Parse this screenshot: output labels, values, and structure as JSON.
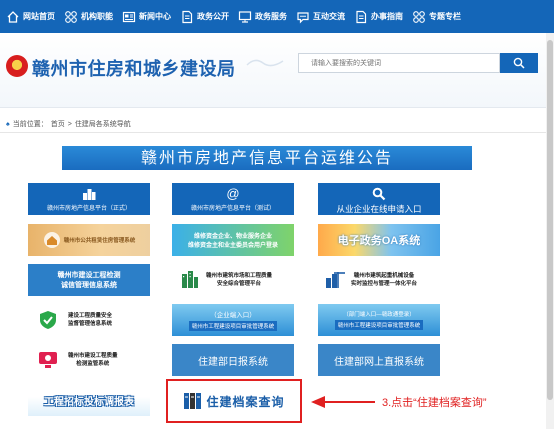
{
  "nav": {
    "items": [
      {
        "label": "网站首页",
        "icon": "home-icon"
      },
      {
        "label": "机构职能",
        "icon": "grid-icon"
      },
      {
        "label": "新闻中心",
        "icon": "news-icon"
      },
      {
        "label": "政务公开",
        "icon": "document-icon"
      },
      {
        "label": "政务服务",
        "icon": "monitor-icon"
      },
      {
        "label": "互动交流",
        "icon": "chat-icon"
      },
      {
        "label": "办事指南",
        "icon": "document-icon"
      },
      {
        "label": "专题专栏",
        "icon": "grid-icon"
      }
    ]
  },
  "header": {
    "site_title": "赣州市住房和城乡建设局",
    "search_placeholder": "请输入要搜索的关键词"
  },
  "breadcrumb": {
    "prefix": "当前位置：",
    "home": "首页",
    "separator": ">",
    "current": "住建局各系统导航"
  },
  "banner": {
    "title": "赣州市房地产信息平台运维公告"
  },
  "tiles": {
    "r1c1": "赣州市房地产信息平台（正式）",
    "r1c2": "赣州市房地产信息平台（测试）",
    "r1c3": "从业企业在线申请入口",
    "r2c1": "赣州市公共租赁住房管理系统",
    "r2c2_line1": "维修资金企业、物业服务企业",
    "r2c2_line2": "维修资金主和业主委员会用户登录",
    "r2c3": "电子政务OA系统",
    "r3c1_line1": "赣州市建设工程检测",
    "r3c1_line2": "诚信管理信息系统",
    "r3c2_line1": "赣州市建筑市场和工程质量",
    "r3c2_line2": "安全综合管理平台",
    "r3c3_line1": "赣州市建筑起重机械设备",
    "r3c3_line2": "实时监控与管理一体化平台",
    "r4c1_line1": "建设工程质量安全",
    "r4c1_line2": "监督管理信息系统",
    "r4c2_top": "（企业端入口）",
    "r4c2_bottom": "赣州市工程建设项目审批管理系统",
    "r4c3_top": "（部门端入口—赣政通登录）",
    "r4c3_bottom": "赣州市工程建设项目审批管理系统",
    "r5c1_line1": "赣州市建设工程质量",
    "r5c1_line2": "检测监管系统",
    "r5c2": "住建部日报系统",
    "r5c3": "住建部网上直报系统",
    "r6c1": "工程招标投标调报表",
    "r6c2": "住建档案查询"
  },
  "annotation": {
    "text": "3.点击“住建档案查询”"
  },
  "colors": {
    "nav_bg": "#1466b8",
    "title_blue": "#1e62b0",
    "annotation_red": "#e02020"
  }
}
